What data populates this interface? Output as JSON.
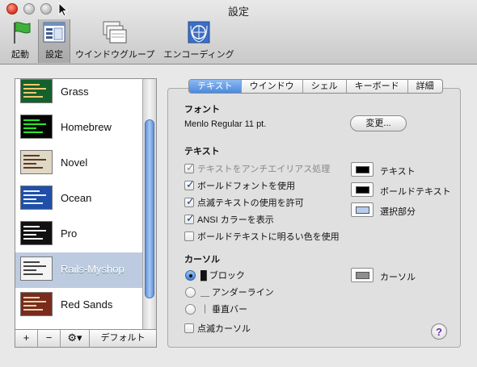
{
  "window": {
    "title": "設定"
  },
  "toolbar": {
    "items": [
      {
        "label": "起動",
        "icon": "flag-icon"
      },
      {
        "label": "設定",
        "icon": "settings-window-icon",
        "selected": true
      },
      {
        "label": "ウインドウグループ",
        "icon": "window-group-icon"
      },
      {
        "label": "エンコーディング",
        "icon": "encoding-globe-icon"
      }
    ]
  },
  "profiles": [
    {
      "name": "Grass",
      "bg": "#14612d",
      "fg": "#f0c870"
    },
    {
      "name": "Homebrew",
      "bg": "#050505",
      "fg": "#28e928"
    },
    {
      "name": "Novel",
      "bg": "#dfd8c4",
      "fg": "#5b3a28"
    },
    {
      "name": "Ocean",
      "bg": "#1f4fa8",
      "fg": "#e8f0ff"
    },
    {
      "name": "Pro",
      "bg": "#111111",
      "fg": "#f2f2f2"
    },
    {
      "name": "Rails-Myshop",
      "bg": "#f4f4f4",
      "fg": "#444444",
      "selected": true
    },
    {
      "name": "Red Sands",
      "bg": "#7a2b1d",
      "fg": "#e8d6a8"
    }
  ],
  "list_buttons": {
    "add": "+",
    "remove": "−",
    "gear": "⚙▾",
    "default": "デフォルト"
  },
  "tabs": [
    "テキスト",
    "ウインドウ",
    "シェル",
    "キーボード",
    "詳細"
  ],
  "active_tab": "テキスト",
  "font": {
    "section": "フォント",
    "value": "Menlo Regular 11 pt.",
    "change_button": "変更..."
  },
  "text_section": {
    "section": "テキスト",
    "options": [
      {
        "label": "テキストをアンチエイリアス処理",
        "checked": true,
        "disabled": true
      },
      {
        "label": "ボールドフォントを使用",
        "checked": true,
        "disabled": false
      },
      {
        "label": "点滅テキストの使用を許可",
        "checked": true,
        "disabled": false
      },
      {
        "label": "ANSI カラーを表示",
        "checked": true,
        "disabled": false
      },
      {
        "label": "ボールドテキストに明るい色を使用",
        "checked": false,
        "disabled": false
      }
    ],
    "colors": [
      {
        "label": "テキスト",
        "color": "#000000"
      },
      {
        "label": "ボールドテキスト",
        "color": "#000000"
      },
      {
        "label": "選択部分",
        "color": "#b7cdf0"
      }
    ]
  },
  "cursor_section": {
    "section": "カーソル",
    "styles": [
      {
        "label": "█ ブロック",
        "selected": true
      },
      {
        "label": "＿ アンダーライン",
        "selected": false
      },
      {
        "label": "｜ 垂直バー",
        "selected": false
      }
    ],
    "blink_label": "点滅カーソル",
    "blink_checked": false,
    "color_label": "カーソル",
    "color": "#8e8e8e"
  },
  "help": "?"
}
